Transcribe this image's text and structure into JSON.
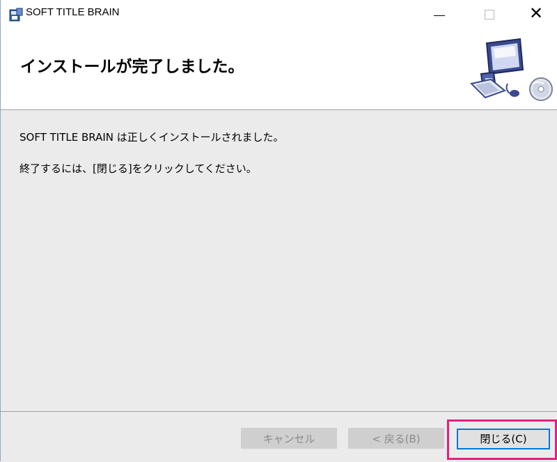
{
  "window": {
    "title": "SOFT TITLE BRAIN",
    "controls": {
      "minimize": "minimize",
      "maximize": "maximize",
      "close": "close"
    }
  },
  "banner": {
    "heading": "インストールが完了しました。",
    "image_icon": "computer-with-cd-icon"
  },
  "content": {
    "message_line1": "SOFT TITLE BRAIN は正しくインストールされました。",
    "message_line2": "終了するには、[閉じる]をクリックしてください。"
  },
  "buttons": {
    "cancel_label": "キャンセル",
    "back_label": "< 戻る(B)",
    "close_label": "閉じる(C)"
  },
  "colors": {
    "highlight": "#e0217f",
    "focus_border": "#0078d7",
    "panel_background": "#ebebeb"
  }
}
